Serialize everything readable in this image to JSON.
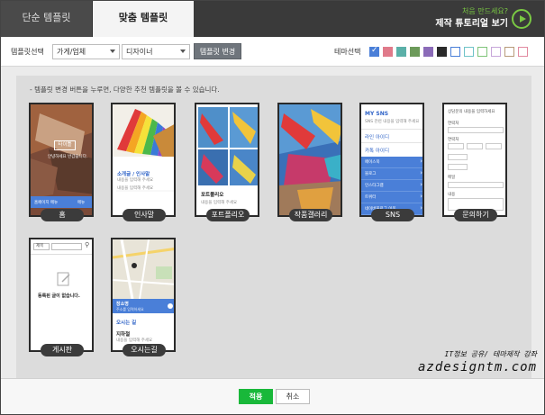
{
  "header": {
    "tab_simple": "단순 템플릿",
    "tab_custom": "맞춤 템플릿",
    "promo_small": "처음 만드세요?",
    "promo_big": "제작 튜토리얼 보기"
  },
  "toolbar": {
    "template_select_label": "템플릿선택",
    "category_value": "가게/업체",
    "designer_value": "디자이너",
    "change_button": "템플릿 변경",
    "theme_label": "테마선택",
    "theme_colors": [
      "#4a7fd8",
      "#e07a8a",
      "#5bb0a8",
      "#6c9a5a",
      "#8b6bb8",
      "#2a2a2a",
      "#4a7fd8",
      "#6fc3c8",
      "#7fc47a",
      "#c7a6d9",
      "#b89a7a",
      "#e28aa0"
    ]
  },
  "notice": "- 템플릿 변경 버튼을 누루면, 다양한 추천 템플릿을 볼 수 있습니다.",
  "cards": {
    "home": {
      "label": "홈",
      "title_box": "타이틀",
      "sub": "안녕하세요 반갑습니다.",
      "bar_left": "홈페이지 메뉴",
      "bar_right": "메뉴"
    },
    "greeting": {
      "label": "인사말",
      "title": "소개글 / 인사말",
      "line": "내용을 입력해 주세요"
    },
    "portfolio": {
      "label": "포트폴리오",
      "title": "포트폴리오",
      "line": "내용을 입력해 주세요"
    },
    "gallery": {
      "label": "작품갤러리"
    },
    "sns": {
      "label": "SNS",
      "title": "MY SNS",
      "sub": "SNS 관련 내용을 입력해 주세요",
      "link1": "라인 아이디",
      "link2": "카톡 아이디",
      "menu": [
        "페이스북",
        "블로그",
        "인스타그램",
        "트위터",
        "네이버블로그 이웃"
      ]
    },
    "inquiry": {
      "label": "문의하기",
      "title": "상담문의 내용을 입력하세요",
      "f1": "연락처",
      "f2": "연락처",
      "f3": "메일",
      "f4": "내용"
    },
    "board": {
      "label": "게시판",
      "select_value": "제목",
      "empty": "등록된 글이 없습니다."
    },
    "directions": {
      "label": "오시는길",
      "place": "장소명",
      "place_sub": "주소를 입력하세요",
      "title": "오시는 길",
      "sub_title": "지하철",
      "line": "내용을 입력해 주세요"
    }
  },
  "watermark": {
    "line1": "IT정보 공유/ 테마제작 강좌",
    "line2": "azdesigntm.com"
  },
  "buttons": {
    "apply": "적용",
    "cancel": "취소"
  }
}
